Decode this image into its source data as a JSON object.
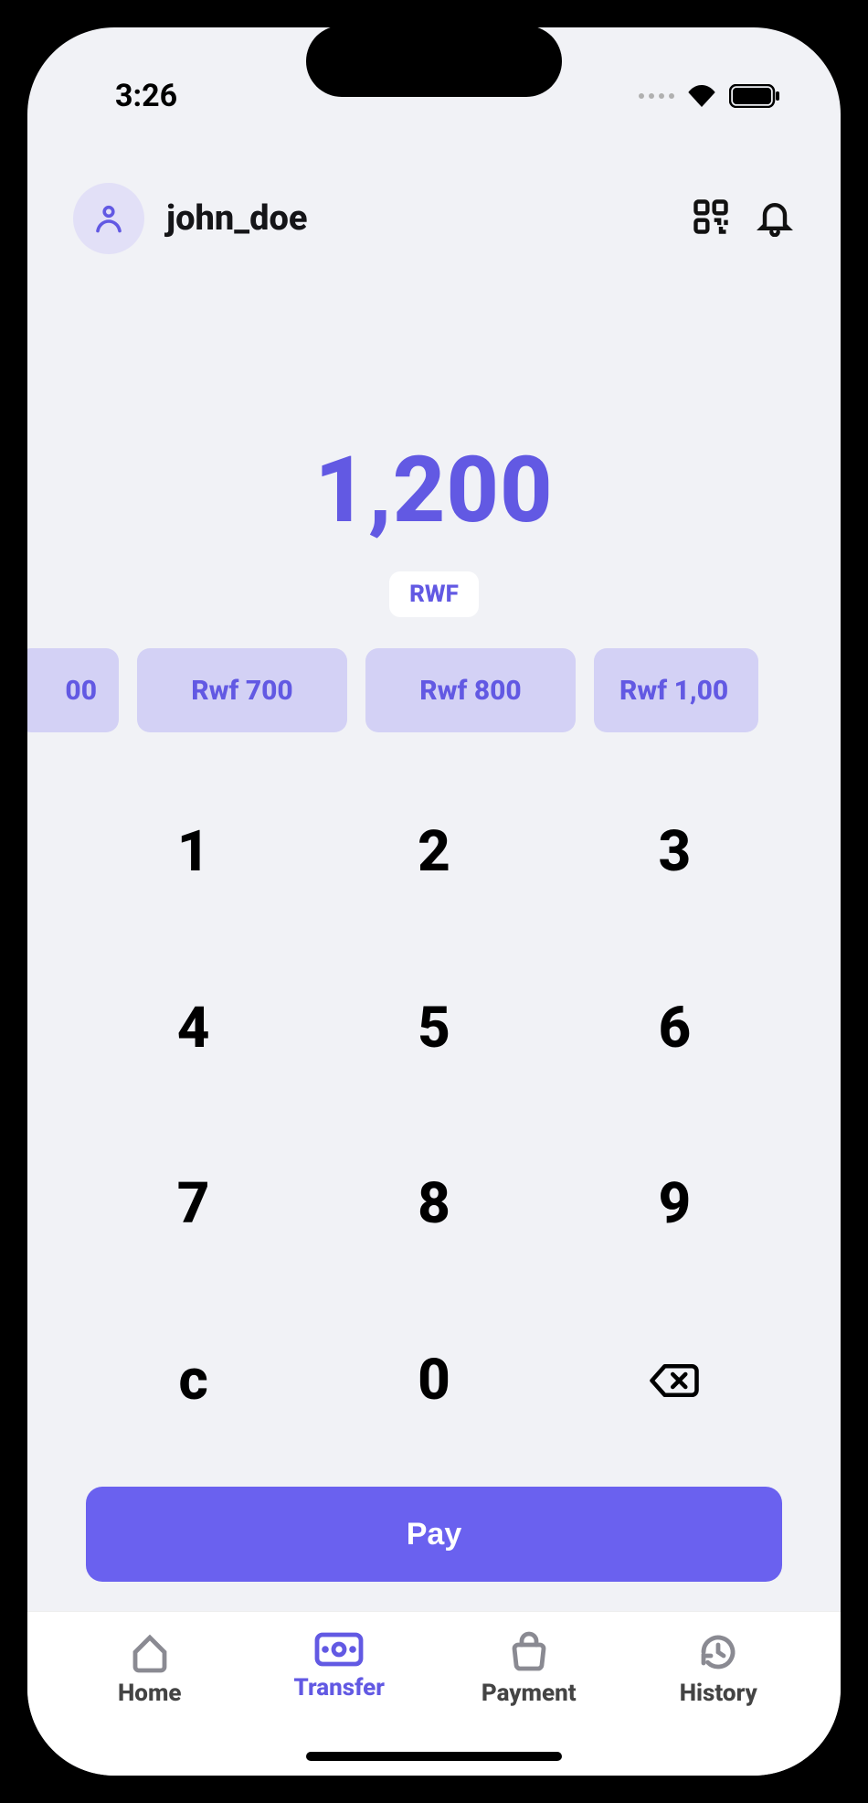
{
  "status": {
    "time": "3:26"
  },
  "header": {
    "username": "john_doe"
  },
  "amount": {
    "value": "1,200",
    "currency": "RWF"
  },
  "presets": [
    {
      "label": "00"
    },
    {
      "label": "Rwf 700"
    },
    {
      "label": "Rwf 800"
    },
    {
      "label": "Rwf 1,00"
    }
  ],
  "keypad": {
    "k1": "1",
    "k2": "2",
    "k3": "3",
    "k4": "4",
    "k5": "5",
    "k6": "6",
    "k7": "7",
    "k8": "8",
    "k9": "9",
    "kc": "c",
    "k0": "0"
  },
  "actions": {
    "pay": "Pay"
  },
  "tabs": {
    "home": "Home",
    "transfer": "Transfer",
    "payment": "Payment",
    "history": "History",
    "active": "transfer"
  }
}
